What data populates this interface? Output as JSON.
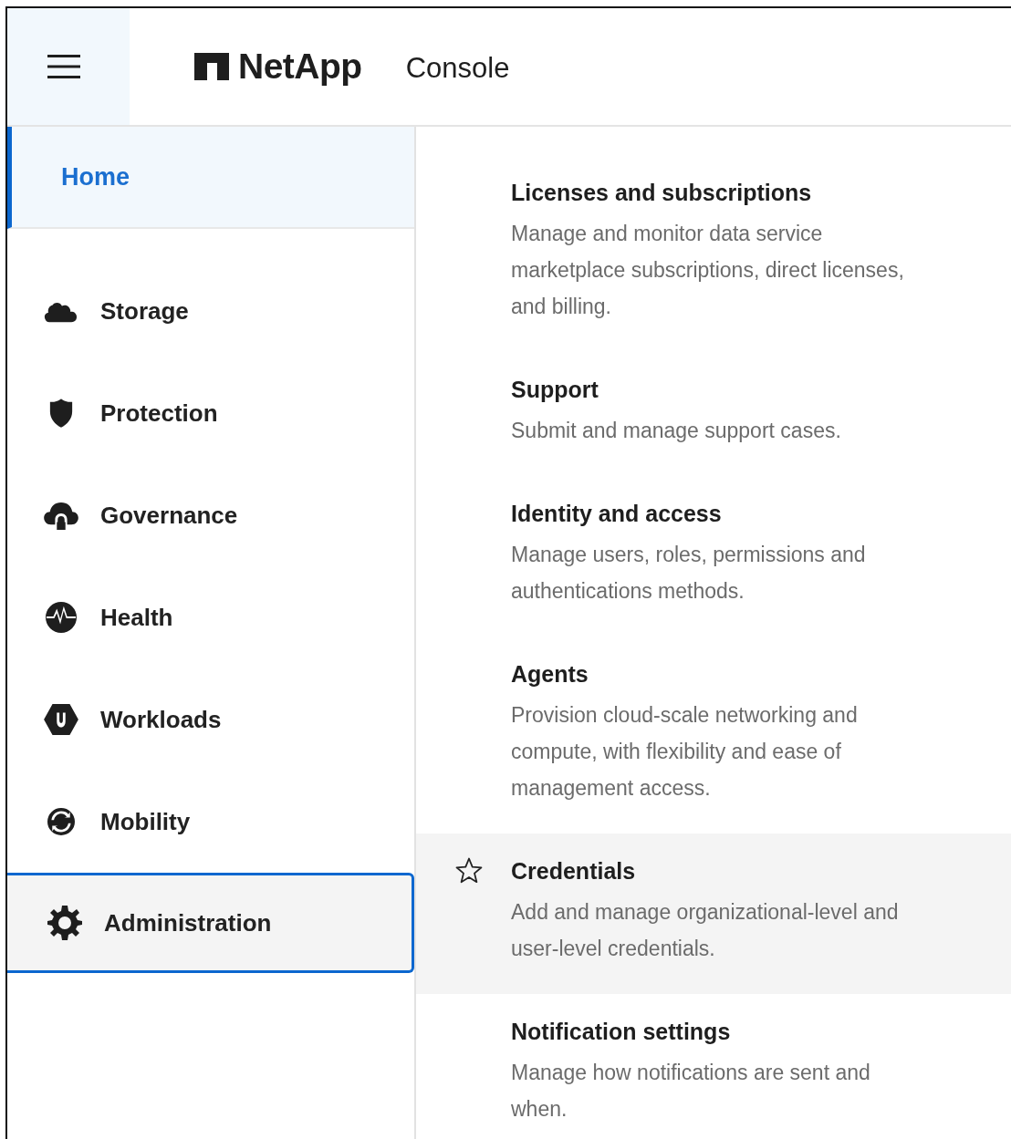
{
  "header": {
    "brand": "NetApp",
    "product": "Console"
  },
  "sidebar": {
    "items": [
      {
        "label": "Home",
        "kind": "home",
        "selected": true,
        "focused": false
      },
      {
        "label": "Storage",
        "kind": "storage",
        "selected": false,
        "focused": false
      },
      {
        "label": "Protection",
        "kind": "protection",
        "selected": false,
        "focused": false
      },
      {
        "label": "Governance",
        "kind": "governance",
        "selected": false,
        "focused": false
      },
      {
        "label": "Health",
        "kind": "health",
        "selected": false,
        "focused": false
      },
      {
        "label": "Workloads",
        "kind": "workloads",
        "selected": false,
        "focused": false
      },
      {
        "label": "Mobility",
        "kind": "mobility",
        "selected": false,
        "focused": false
      },
      {
        "label": "Administration",
        "kind": "administration",
        "selected": false,
        "focused": true
      }
    ]
  },
  "menu": {
    "items": [
      {
        "title": "Licenses and subscriptions",
        "description": "Manage and monitor data service marketplace subscriptions, direct licenses, and billing.",
        "highlighted": false
      },
      {
        "title": "Support",
        "description": "Submit and manage support cases.",
        "highlighted": false
      },
      {
        "title": "Identity and access",
        "description": "Manage users, roles, permissions and authentications methods.",
        "highlighted": false
      },
      {
        "title": "Agents",
        "description": "Provision cloud-scale networking and compute, with flexibility and ease of management access.",
        "highlighted": false
      },
      {
        "title": "Credentials",
        "description": "Add and manage organizational-level and user-level credentials.",
        "highlighted": true
      },
      {
        "title": "Notification settings",
        "description": "Manage how notifications are sent and when.",
        "highlighted": false
      }
    ]
  }
}
